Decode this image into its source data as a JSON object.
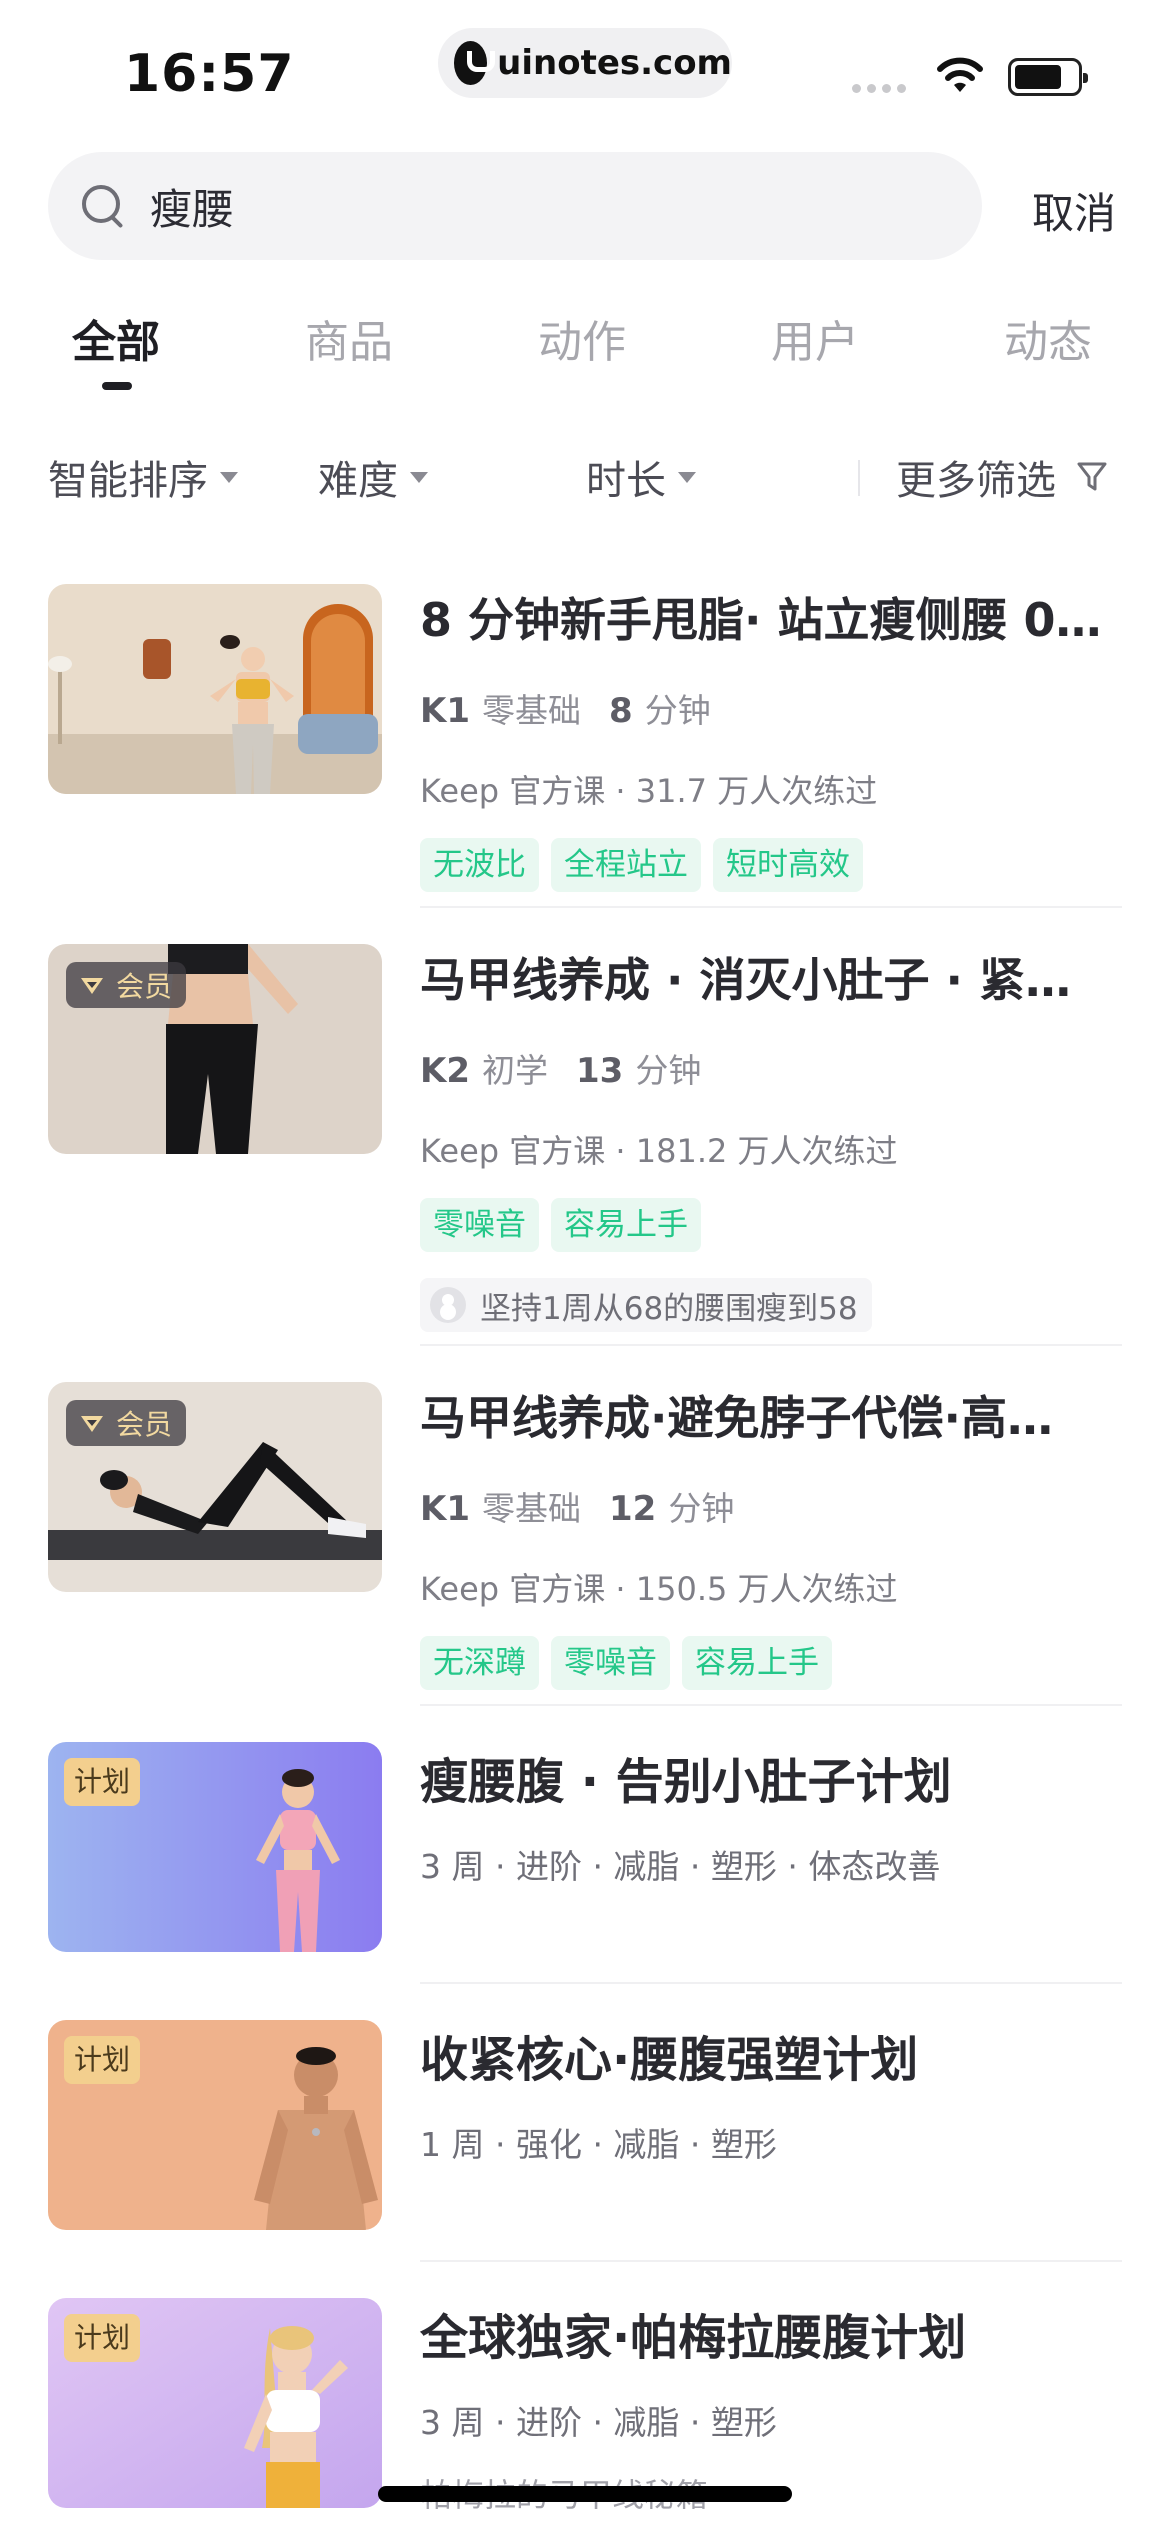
{
  "status_bar": {
    "time": "16:57",
    "url": "uinotes.com"
  },
  "search": {
    "query": "瘦腰",
    "cancel_label": "取消"
  },
  "tabs": [
    {
      "label": "全部",
      "active": true
    },
    {
      "label": "商品",
      "active": false
    },
    {
      "label": "动作",
      "active": false
    },
    {
      "label": "用户",
      "active": false
    },
    {
      "label": "动态",
      "active": false
    }
  ],
  "filters": {
    "sort": "智能排序",
    "difficulty": "难度",
    "duration": "时长",
    "more": "更多筛选"
  },
  "courses": [
    {
      "title": "8 分钟新手甩脂· 站立瘦侧腰 0…",
      "level": "K1",
      "level_name": "零基础",
      "minutes": "8",
      "minutes_unit": "分钟",
      "meta": "Keep 官方课 · 31.7 万人次练过",
      "tags": [
        "无波比",
        "全程站立",
        "短时高效"
      ],
      "vip": false
    },
    {
      "title": "马甲线养成 · 消灭小肚子 · 紧…",
      "level": "K2",
      "level_name": "初学",
      "minutes": "13",
      "minutes_unit": "分钟",
      "meta": "Keep 官方课 · 181.2 万人次练过",
      "tags": [
        "零噪音",
        "容易上手"
      ],
      "comment": "坚持1周从68的腰围瘦到58",
      "vip": true,
      "vip_label": "会员"
    },
    {
      "title": "马甲线养成·避免脖子代偿·高…",
      "level": "K1",
      "level_name": "零基础",
      "minutes": "12",
      "minutes_unit": "分钟",
      "meta": "Keep 官方课 · 150.5 万人次练过",
      "tags": [
        "无深蹲",
        "零噪音",
        "容易上手"
      ],
      "vip": true,
      "vip_label": "会员"
    }
  ],
  "plans": [
    {
      "badge": "计划",
      "title": "瘦腰腹 · 告别小肚子计划",
      "meta": "3 周 · 进阶 · 减脂 · 塑形 · 体态改善",
      "bg": "#9aa6f0"
    },
    {
      "badge": "计划",
      "title": "收紧核心·腰腹强塑计划",
      "meta": "1 周 · 强化 · 减脂 · 塑形",
      "bg": "#efb28c"
    },
    {
      "badge": "计划",
      "title": "全球独家·帕梅拉腰腹计划",
      "meta": "3 周 · 进阶 · 减脂 · 塑形",
      "sub": "帕梅拉的马甲线秘籍",
      "bg": "#d4b8f2"
    }
  ],
  "colors": {
    "tag_green": "#24c789",
    "tag_bg": "#e9f8f1",
    "vip_gold": "#f2d9a0",
    "plan_badge": "#f3cf8e"
  }
}
